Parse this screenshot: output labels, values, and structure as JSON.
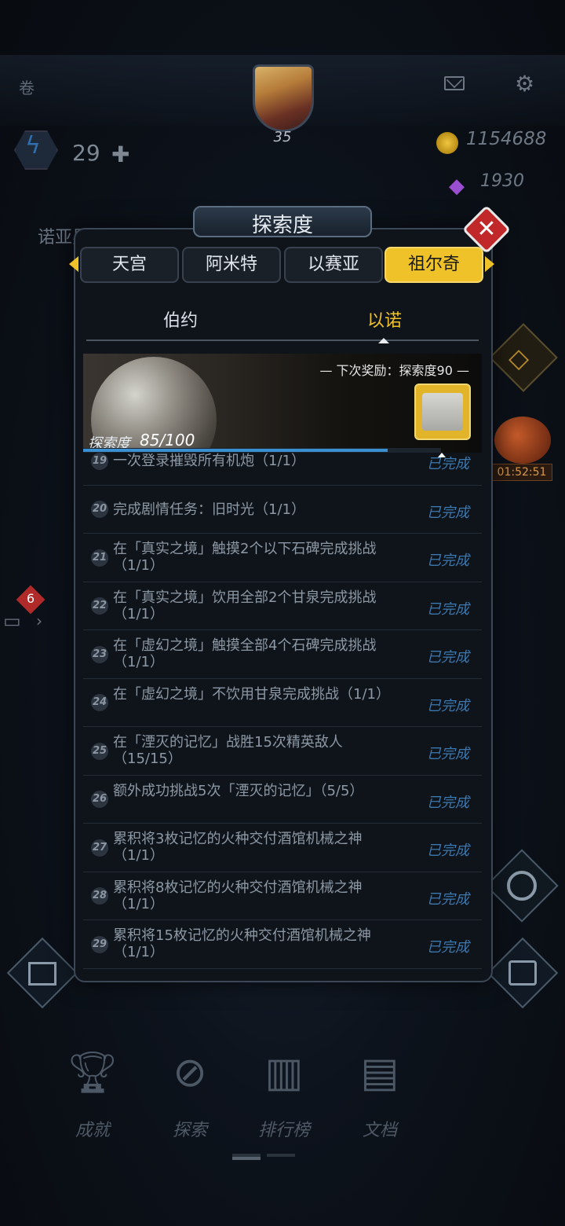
{
  "hud": {
    "scroll_label": "卷",
    "player_level": "35",
    "energy_count": "29",
    "coins": "1154688",
    "gems": "1930",
    "area_name": "诺亚星系",
    "pet_timer": "01:52:51",
    "left_badge": "6"
  },
  "modal": {
    "title": "探索度",
    "close_symbol": "✕",
    "tabs": [
      {
        "label": "天宫",
        "active": false
      },
      {
        "label": "阿米特",
        "active": false
      },
      {
        "label": "以赛亚",
        "active": false
      },
      {
        "label": "祖尔奇",
        "active": true
      }
    ],
    "subtabs": [
      {
        "label": "伯约",
        "active": false
      },
      {
        "label": "以诺",
        "active": true
      }
    ],
    "banner": {
      "next_reward": "—    下次奖励：探索度90    —",
      "explore_label": "探索度",
      "explore_value": "85/100",
      "progress": 0.85
    },
    "tasks": [
      {
        "num": "19",
        "text": "一次登录摧毁所有机炮（1/1）",
        "status": "已完成"
      },
      {
        "num": "20",
        "text": "完成剧情任务：旧时光（1/1）",
        "status": "已完成"
      },
      {
        "num": "21",
        "text": "在「真实之境」触摸2个以下石碑完成挑战（1/1）",
        "status": "已完成"
      },
      {
        "num": "22",
        "text": "在「真实之境」饮用全部2个甘泉完成挑战（1/1）",
        "status": "已完成"
      },
      {
        "num": "23",
        "text": "在「虚幻之境」触摸全部4个石碑完成挑战（1/1）",
        "status": "已完成"
      },
      {
        "num": "24",
        "text": "在「虚幻之境」不饮用甘泉完成挑战（1/1）",
        "status": "已完成"
      },
      {
        "num": "25",
        "text": "在「湮灭的记忆」战胜15次精英敌人（15/15）",
        "status": "已完成"
      },
      {
        "num": "26",
        "text": "额外成功挑战5次「湮灭的记忆」（5/5）",
        "status": "已完成"
      },
      {
        "num": "27",
        "text": "累积将3枚记忆的火种交付酒馆机械之神（1/1）",
        "status": "已完成"
      },
      {
        "num": "28",
        "text": "累积将8枚记忆的火种交付酒馆机械之神（1/1）",
        "status": "已完成"
      },
      {
        "num": "29",
        "text": "累积将15枚记忆的火种交付酒馆机械之神（1/1）",
        "status": "已完成"
      }
    ]
  },
  "nav": [
    {
      "label": "成就",
      "icon": "trophy-icon"
    },
    {
      "label": "探索",
      "icon": "compass-icon"
    },
    {
      "label": "排行榜",
      "icon": "podium-icon"
    },
    {
      "label": "文档",
      "icon": "newspaper-icon"
    }
  ],
  "colors": {
    "accent_gold": "#f0c22a",
    "completed_blue": "#3c78b0",
    "close_red": "#c0282a"
  }
}
